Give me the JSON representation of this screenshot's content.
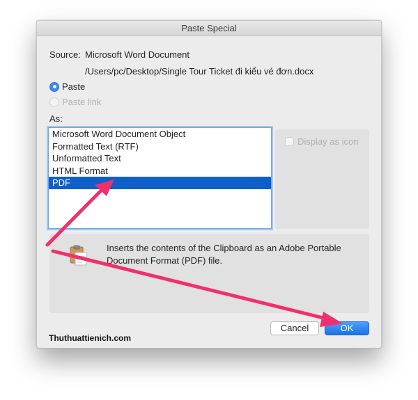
{
  "dialog": {
    "title": "Paste Special",
    "source_label": "Source:",
    "source_name": "Microsoft Word Document",
    "source_path": "/Users/pc/Desktop/Single Tour Ticket đi kiểu vé đơn.docx",
    "paste_label": "Paste",
    "paste_link_label": "Paste link",
    "as_label": "As:",
    "formats": [
      "Microsoft Word Document Object",
      "Formatted Text (RTF)",
      "Unformatted Text",
      "HTML Format",
      "PDF"
    ],
    "selected_format": "PDF",
    "display_as_icon_label": "Display as icon",
    "result_text": "Inserts the contents of the Clipboard as an Adobe Portable Document Format (PDF) file.",
    "cancel_label": "Cancel",
    "ok_label": "OK"
  },
  "watermark": "Thuthuattienich.com",
  "colors": {
    "accent": "#3b8af4",
    "selection": "#0f5fc9",
    "annotation_arrow": "#f0306d"
  },
  "icons": {
    "clipboard": "clipboard-icon"
  }
}
